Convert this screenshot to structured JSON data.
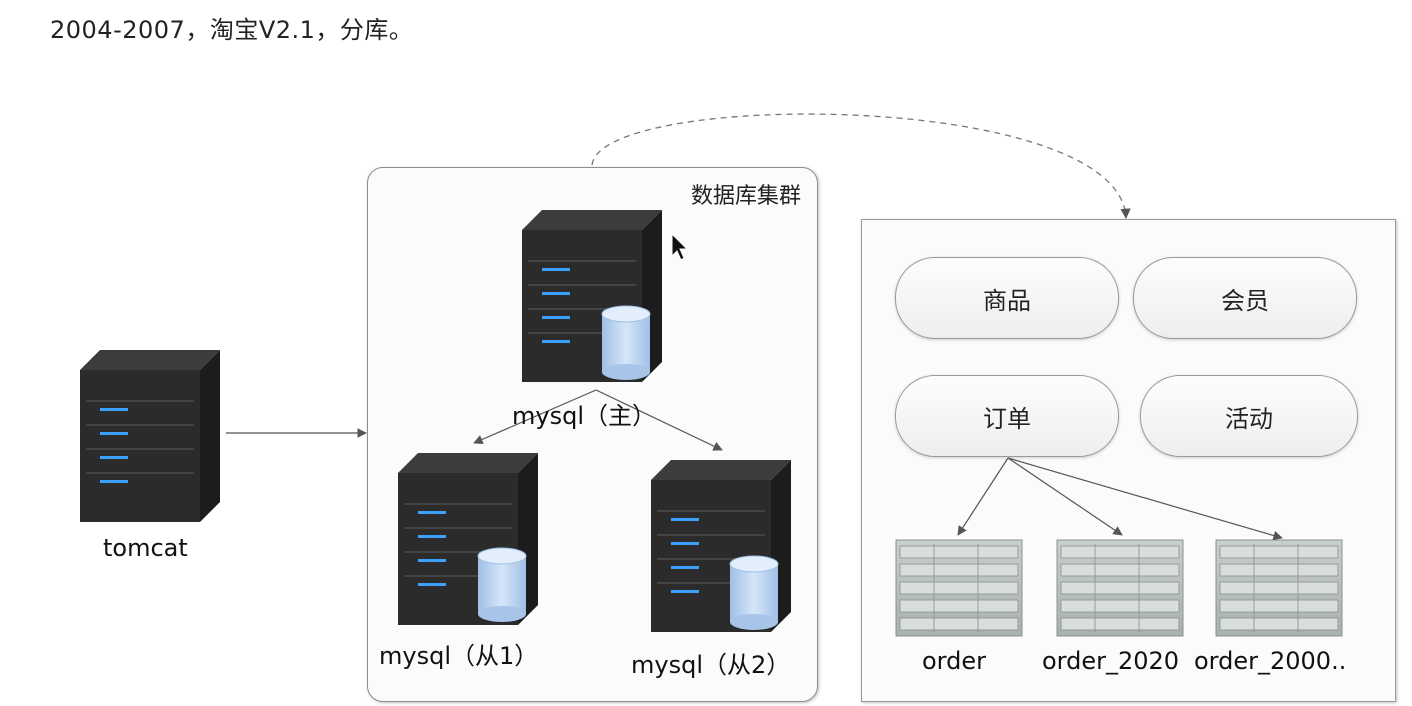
{
  "heading": "2004-2007，淘宝V2.1，分库。",
  "nodes": {
    "tomcat": "tomcat",
    "master": "mysql（主）",
    "slave1": "mysql（从1）",
    "slave2": "mysql（从2）"
  },
  "cluster": {
    "title": "数据库集群"
  },
  "modules": {
    "goods": "商品",
    "member": "会员",
    "order": "订单",
    "activity": "活动"
  },
  "tables": [
    "order",
    "order_2020",
    "order_2000.."
  ],
  "icons": {
    "server": "server-icon",
    "database": "database-cylinder-icon",
    "table": "table-grid-icon",
    "cursor": "mouse-cursor-icon"
  },
  "colors": {
    "server_body": "#2b2b2b",
    "server_led": "#3aa0ff",
    "cylinder": "#b9d3f0",
    "arrow": "#555555"
  }
}
